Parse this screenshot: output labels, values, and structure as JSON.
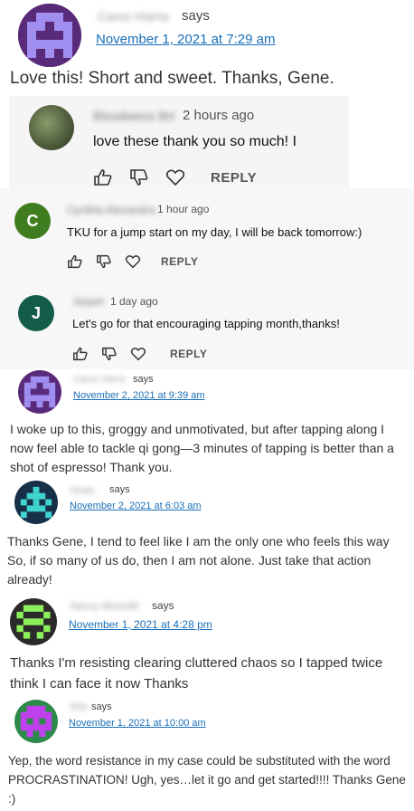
{
  "comments": [
    {
      "name": "Caron Harris",
      "says": "says",
      "date": "November 1, 2021 at 7:29 am",
      "text": "Love this! Short and sweet. Thanks, Gene."
    },
    {
      "name": "Caron Harris",
      "says": "says",
      "date": "November 2, 2021 at 9:39 am",
      "text": "I woke up to this, groggy and unmotivated, but after tapping along I now feel able to tackle qi gong—3 minutes of tapping is better than a shot of espresso! Thank you."
    },
    {
      "name": "Dinah",
      "says": "says",
      "date": "November 2, 2021 at 6:03 am",
      "text": "Thanks Gene, I tend to feel like I am the only one who feels this way So, if so many of us do, then I am not alone. Just take that action already!"
    },
    {
      "name": "Nancy Mesmith",
      "says": "says",
      "date": "November 1, 2021 at 4:28 pm",
      "text": "Thanks I'm resisting clearing cluttered chaos so I tapped twice think I can face it now Thanks"
    },
    {
      "name": "Rob",
      "says": "says",
      "date": "November 1, 2021 at 10:00 am",
      "text": "Yep, the word resistance in my case could be substituted with the word PROCRASTINATION! Ugh, yes…let it go and get started!!!! Thanks Gene :)"
    }
  ],
  "youtube": [
    {
      "initial": "",
      "name": "Bloodwens Brt",
      "time": "2 hours ago",
      "text": "love these thank you so much! I",
      "reply": "REPLY"
    },
    {
      "initial": "C",
      "name": "Cynthia Alexandra",
      "time": "1 hour ago",
      "text": "TKU for a jump start on my day, I will be back tomorrow:)",
      "reply": "REPLY"
    },
    {
      "initial": "J",
      "name": "Jasper",
      "time": "1 day ago",
      "text": "Let's go for that encouraging tapping month,thanks!",
      "reply": "REPLY"
    }
  ],
  "colors": {
    "link": "#1a6fb8",
    "c_avatar": "#3f7d20",
    "j_avatar": "#135c4a"
  }
}
